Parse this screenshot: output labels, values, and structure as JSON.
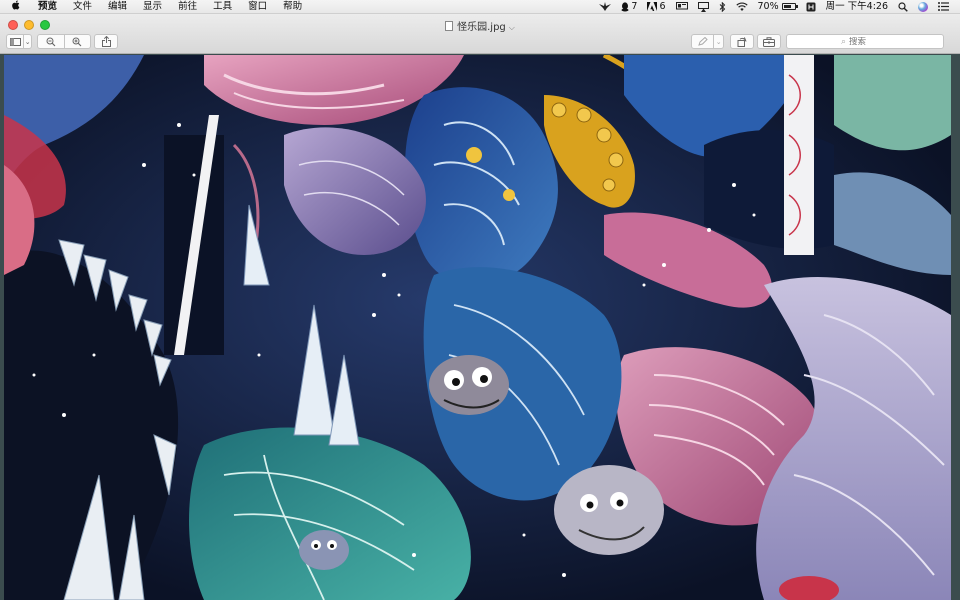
{
  "menubar": {
    "apple_icon": "apple-logo-icon",
    "items": [
      "预览",
      "文件",
      "编辑",
      "显示",
      "前往",
      "工具",
      "窗口",
      "帮助"
    ],
    "status": {
      "notification_count": "7",
      "adobe_count": "6",
      "battery_percent": "70%",
      "battery_level": 0.7,
      "clock": "周一 下午4:26"
    }
  },
  "window": {
    "title": "怪乐园.jpg",
    "toolbar": {
      "search_placeholder": "搜索"
    }
  },
  "image": {
    "description_colors": {
      "deep_blue": "#1b3a7a",
      "teal": "#2a8c8e",
      "pink": "#d77aa0",
      "violet": "#7d6aa8",
      "night": "#0c1426",
      "gold": "#d9a21e",
      "red": "#c8344a"
    }
  }
}
